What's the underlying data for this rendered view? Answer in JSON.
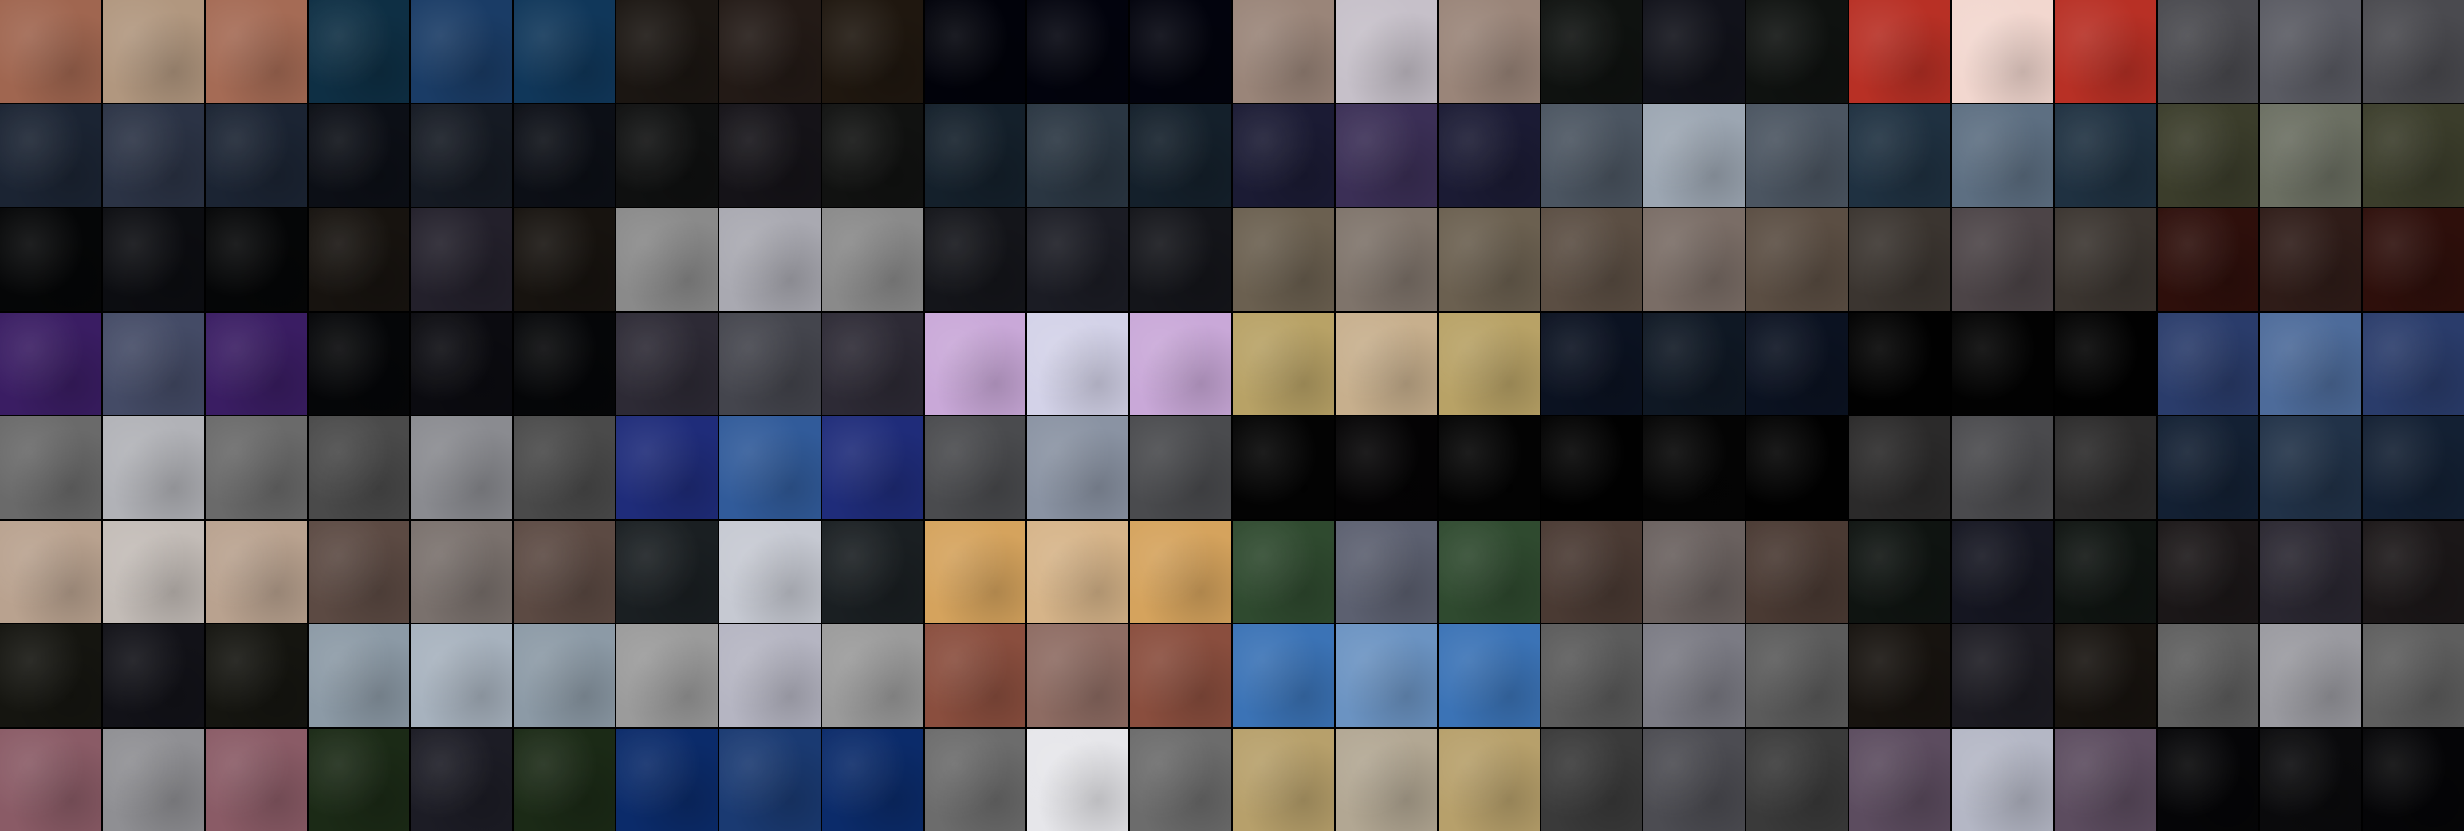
{
  "mosaic": {
    "rows": 8,
    "cols": 24,
    "palette": [
      [
        "#a06650",
        "#b1977f",
        "#a56b55",
        "#0e2f44",
        "#1a3c66",
        "#10375a",
        "#1b1612",
        "#231a16",
        "#1f170f",
        "#01020a",
        "#02030d",
        "#02030d",
        "#9a8579",
        "#c6c0c9",
        "#9a8579",
        "#0f1210",
        "#11121a",
        "#0f1210",
        "#b83025",
        "#f2d7cf",
        "#b83025",
        "#4a4a4f",
        "#5a5b63",
        "#4a4a4f"
      ],
      [
        "#1b2433",
        "#2b3345",
        "#1b2433",
        "#0c0f16",
        "#151a23",
        "#0c0f16",
        "#0f1010",
        "#151318",
        "#111211",
        "#14202b",
        "#2a3642",
        "#14202b",
        "#1b1b34",
        "#3b2f56",
        "#1b1b34",
        "#4b5561",
        "#9ca6b2",
        "#4b5561",
        "#1f3141",
        "#5d6f82",
        "#1f3141",
        "#3b3d2b",
        "#6b6f62",
        "#3b3d2b"
      ],
      [
        "#050607",
        "#0c0d11",
        "#050607",
        "#17130f",
        "#23202b",
        "#17130f",
        "#8a8a8a",
        "#a9a9b1",
        "#8a8a8a",
        "#14151a",
        "#1b1c24",
        "#14151a",
        "#6b6050",
        "#7f746b",
        "#6b6050",
        "#5b4e43",
        "#7a6d66",
        "#5b4e43",
        "#3b3530",
        "#4c4447",
        "#3b3530",
        "#2e0f0b",
        "#2f1c18",
        "#2e0f0b"
      ],
      [
        "#3a1d63",
        "#444b66",
        "#3a1d63",
        "#050608",
        "#0b0b10",
        "#050608",
        "#2d2a35",
        "#44454d",
        "#2d2a35",
        "#c9a8d8",
        "#d3d2e8",
        "#c9a8d8",
        "#b8a266",
        "#c7af8d",
        "#b8a266",
        "#0b1221",
        "#0f1824",
        "#0b1221",
        "#010101",
        "#020202",
        "#010101",
        "#2a3c6b",
        "#4d6b9a",
        "#2a3c6b"
      ],
      [
        "#6a6a6a",
        "#b1b2b7",
        "#6a6a6a",
        "#4a4a4a",
        "#8a8b90",
        "#4a4a4a",
        "#1f2c7a",
        "#315b9a",
        "#1f2c7a",
        "#4a4b4e",
        "#8a93a3",
        "#4a4b4e",
        "#030303",
        "#040304",
        "#030303",
        "#010101",
        "#040404",
        "#010101",
        "#2b2a2a",
        "#4a4a4d",
        "#2b2a2a",
        "#132033",
        "#213248",
        "#132033"
      ],
      [
        "#b9a28f",
        "#c3bcb7",
        "#b9a28f",
        "#5c4a43",
        "#7a716d",
        "#5c4a43",
        "#1a1f22",
        "#c6c9d2",
        "#1a1f22",
        "#d5a35d",
        "#d6b489",
        "#d5a35d",
        "#2f4a2f",
        "#5c6070",
        "#2f4a2f",
        "#4a3a33",
        "#6a615f",
        "#4a3a33",
        "#0f1411",
        "#151621",
        "#0f1411",
        "#1b1718",
        "#2a2731",
        "#1b1718"
      ],
      [
        "#151510",
        "#121218",
        "#151510",
        "#8c9aa6",
        "#a7b2be",
        "#8c9aa6",
        "#9b9b9b",
        "#b5b5c2",
        "#9b9b9b",
        "#8a4e3e",
        "#8e6c63",
        "#8a4e3e",
        "#3b73b6",
        "#6b93c2",
        "#3b73b6",
        "#5b5b5b",
        "#7b7b84",
        "#5b5b5b",
        "#17130f",
        "#1c1b22",
        "#17130f",
        "#5e5e5e",
        "#9a9aa0",
        "#5e5e5e"
      ],
      [
        "#8a5b66",
        "#8f8f93",
        "#8a5b66",
        "#1b2a16",
        "#1c1c25",
        "#1b2a16",
        "#0b2b6a",
        "#1a3a72",
        "#0b2b6a",
        "#6c6c6c",
        "#e6e6ea",
        "#6c6c6c",
        "#b7a06b",
        "#b2a793",
        "#b7a06b",
        "#3a3a3a",
        "#4c4c52",
        "#3a3a3a",
        "#5c4c5f",
        "#b4b7c5",
        "#5c4c5f",
        "#050507",
        "#0a0a0c",
        "#050507"
      ]
    ]
  }
}
